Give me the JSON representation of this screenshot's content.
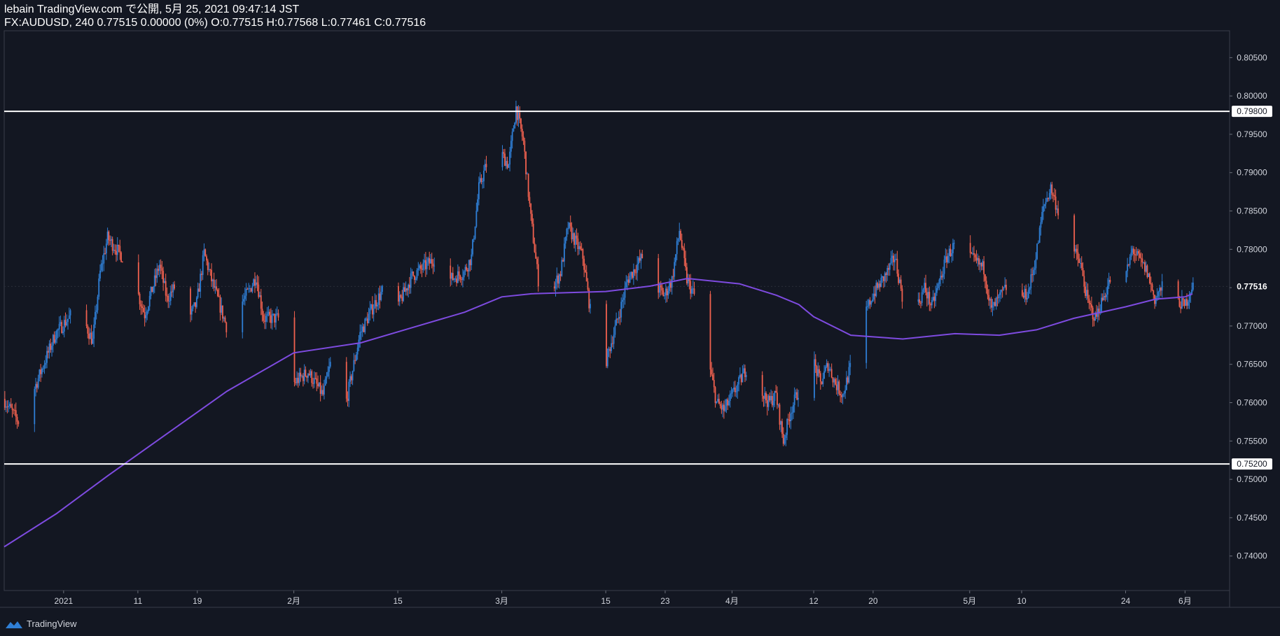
{
  "header": {
    "line1": "lebain TradingView.com で公開, 5月 25, 2021 09:47:14 JST",
    "line2": "FX:AUDUSD, 240 0.77515 0.00000 (0%) O:0.77515 H:0.77568 L:0.77461 C:0.77516"
  },
  "footer": {
    "brand": "TradingView",
    "logo_icon": "tradingview-cloud-icon"
  },
  "colors": {
    "background": "#131722",
    "up": "#2f7fd6",
    "down": "#f0614f",
    "ma": "#7e4be0",
    "levels": "#ffffff",
    "grid": "#2a2e39"
  },
  "chart_data": {
    "type": "candlestick",
    "symbol": "FX:AUDUSD",
    "interval": "240",
    "ylim": [
      0.7355,
      0.8085
    ],
    "y_ticks": [
      0.805,
      0.8,
      0.795,
      0.79,
      0.785,
      0.78,
      0.775,
      0.77,
      0.765,
      0.76,
      0.755,
      0.75,
      0.745,
      0.74
    ],
    "y_tick_labels": [
      "0.80500",
      "0.80000",
      "0.79500",
      "0.79000",
      "0.78500",
      "0.78000",
      "0.77500",
      "0.77000",
      "0.76500",
      "0.76000",
      "0.75500",
      "0.75000",
      "0.74500",
      "0.74000"
    ],
    "x_range": [
      "2020-12-24",
      "2021-06-07"
    ],
    "x_ticks": [
      {
        "date": "2021-01-01",
        "label": "2021"
      },
      {
        "date": "2021-01-11",
        "label": "11"
      },
      {
        "date": "2021-01-19",
        "label": "19"
      },
      {
        "date": "2021-02-01",
        "label": "2月"
      },
      {
        "date": "2021-02-15",
        "label": "15"
      },
      {
        "date": "2021-03-01",
        "label": "3月"
      },
      {
        "date": "2021-03-15",
        "label": "15"
      },
      {
        "date": "2021-03-23",
        "label": "23"
      },
      {
        "date": "2021-04-01",
        "label": "4月"
      },
      {
        "date": "2021-04-12",
        "label": "12"
      },
      {
        "date": "2021-04-20",
        "label": "20"
      },
      {
        "date": "2021-05-03",
        "label": "5月"
      },
      {
        "date": "2021-05-10",
        "label": "10"
      },
      {
        "date": "2021-05-24",
        "label": "24"
      },
      {
        "date": "2021-06-01",
        "label": "6月"
      }
    ],
    "price_path": [
      [
        "2020-12-24",
        0.7605
      ],
      [
        "2020-12-26",
        0.7575
      ],
      [
        "2020-12-28",
        0.7615
      ],
      [
        "2020-12-31",
        0.769
      ],
      [
        "2021-01-03",
        0.7725
      ],
      [
        "2021-01-05",
        0.768
      ],
      [
        "2021-01-06",
        0.777
      ],
      [
        "2021-01-07",
        0.7815
      ],
      [
        "2021-01-09",
        0.779
      ],
      [
        "2021-01-11",
        0.7745
      ],
      [
        "2021-01-12",
        0.7715
      ],
      [
        "2021-01-14",
        0.778
      ],
      [
        "2021-01-15",
        0.7735
      ],
      [
        "2021-01-17",
        0.7765
      ],
      [
        "2021-01-18",
        0.771
      ],
      [
        "2021-01-19",
        0.773
      ],
      [
        "2021-01-20",
        0.7795
      ],
      [
        "2021-01-21",
        0.776
      ],
      [
        "2021-01-23",
        0.77
      ],
      [
        "2021-01-26",
        0.7745
      ],
      [
        "2021-01-27",
        0.7765
      ],
      [
        "2021-01-28",
        0.771
      ],
      [
        "2021-01-30",
        0.771
      ],
      [
        "2021-02-01",
        0.7625
      ],
      [
        "2021-02-03",
        0.764
      ],
      [
        "2021-02-05",
        0.761
      ],
      [
        "2021-02-06",
        0.765
      ],
      [
        "2021-02-08",
        0.7595
      ],
      [
        "2021-02-10",
        0.769
      ],
      [
        "2021-02-12",
        0.773
      ],
      [
        "2021-02-13",
        0.7745
      ],
      [
        "2021-02-15",
        0.7725
      ],
      [
        "2021-02-17",
        0.7765
      ],
      [
        "2021-02-19",
        0.778
      ],
      [
        "2021-02-21",
        0.7795
      ],
      [
        "2021-02-22",
        0.776
      ],
      [
        "2021-02-24",
        0.777
      ],
      [
        "2021-02-25",
        0.779
      ],
      [
        "2021-02-26",
        0.788
      ],
      [
        "2021-02-27",
        0.791
      ],
      [
        "2021-03-01",
        0.7925
      ],
      [
        "2021-03-02",
        0.791
      ],
      [
        "2021-03-03",
        0.7985
      ],
      [
        "2021-03-04",
        0.794
      ],
      [
        "2021-03-05",
        0.784
      ],
      [
        "2021-03-06",
        0.776
      ],
      [
        "2021-03-07",
        0.773
      ],
      [
        "2021-03-09",
        0.777
      ],
      [
        "2021-03-10",
        0.783
      ],
      [
        "2021-03-12",
        0.779
      ],
      [
        "2021-03-13",
        0.772
      ],
      [
        "2021-03-14",
        0.766
      ],
      [
        "2021-03-15",
        0.765
      ],
      [
        "2021-03-17",
        0.772
      ],
      [
        "2021-03-18",
        0.776
      ],
      [
        "2021-03-20",
        0.779
      ],
      [
        "2021-03-21",
        0.776
      ],
      [
        "2021-03-22",
        0.775
      ],
      [
        "2021-03-23",
        0.774
      ],
      [
        "2021-03-24",
        0.776
      ],
      [
        "2021-03-25",
        0.7825
      ],
      [
        "2021-03-26",
        0.776
      ],
      [
        "2021-03-27",
        0.774
      ],
      [
        "2021-03-29",
        0.765
      ],
      [
        "2021-03-30",
        0.76
      ],
      [
        "2021-03-31",
        0.759
      ],
      [
        "2021-04-02",
        0.7625
      ],
      [
        "2021-04-03",
        0.7645
      ],
      [
        "2021-04-04",
        0.763
      ],
      [
        "2021-04-06",
        0.76
      ],
      [
        "2021-04-07",
        0.761
      ],
      [
        "2021-04-08",
        0.755
      ],
      [
        "2021-04-09",
        0.759
      ],
      [
        "2021-04-10",
        0.7615
      ],
      [
        "2021-04-11",
        0.7635
      ],
      [
        "2021-04-12",
        0.7655
      ],
      [
        "2021-04-13",
        0.7625
      ],
      [
        "2021-04-14",
        0.765
      ],
      [
        "2021-04-15",
        0.7625
      ],
      [
        "2021-04-16",
        0.761
      ],
      [
        "2021-04-17",
        0.7645
      ],
      [
        "2021-04-18",
        0.769
      ],
      [
        "2021-04-20",
        0.774
      ],
      [
        "2021-04-22",
        0.777
      ],
      [
        "2021-04-23",
        0.779
      ],
      [
        "2021-04-24",
        0.774
      ],
      [
        "2021-04-25",
        0.77
      ],
      [
        "2021-04-27",
        0.775
      ],
      [
        "2021-04-28",
        0.7725
      ],
      [
        "2021-04-30",
        0.779
      ],
      [
        "2021-05-01",
        0.7805
      ],
      [
        "2021-05-02",
        0.777
      ],
      [
        "2021-05-03",
        0.779
      ],
      [
        "2021-05-05",
        0.7775
      ],
      [
        "2021-05-06",
        0.772
      ],
      [
        "2021-05-08",
        0.775
      ],
      [
        "2021-05-09",
        0.77
      ],
      [
        "2021-05-10",
        0.7735
      ],
      [
        "2021-05-11",
        0.7745
      ],
      [
        "2021-05-12",
        0.779
      ],
      [
        "2021-05-13",
        0.7855
      ],
      [
        "2021-05-14",
        0.788
      ],
      [
        "2021-05-15",
        0.785
      ],
      [
        "2021-05-16",
        0.782
      ],
      [
        "2021-05-18",
        0.778
      ],
      [
        "2021-05-19",
        0.773
      ],
      [
        "2021-05-20",
        0.771
      ],
      [
        "2021-05-22",
        0.776
      ],
      [
        "2021-05-23",
        0.778
      ],
      [
        "2021-05-24",
        0.776
      ],
      [
        "2021-05-25",
        0.78
      ],
      [
        "2021-05-27",
        0.777
      ],
      [
        "2021-05-28",
        0.7735
      ],
      [
        "2021-05-29",
        0.775
      ],
      [
        "2021-05-30",
        0.777
      ],
      [
        "2021-05-31",
        0.7735
      ],
      [
        "2021-06-01",
        0.7725
      ],
      [
        "2021-06-02",
        0.7752
      ]
    ],
    "moving_average": {
      "points": [
        [
          "2020-12-24",
          0.7412
        ],
        [
          "2020-12-31",
          0.7455
        ],
        [
          "2021-01-07",
          0.7505
        ],
        [
          "2021-01-15",
          0.756
        ],
        [
          "2021-01-23",
          0.7615
        ],
        [
          "2021-02-01",
          0.7665
        ],
        [
          "2021-02-10",
          0.7678
        ],
        [
          "2021-02-17",
          0.7698
        ],
        [
          "2021-02-24",
          0.7718
        ],
        [
          "2021-03-01",
          0.7738
        ],
        [
          "2021-03-05",
          0.7742
        ],
        [
          "2021-03-15",
          0.7745
        ],
        [
          "2021-03-21",
          0.7752
        ],
        [
          "2021-03-26",
          0.7762
        ],
        [
          "2021-04-02",
          0.7755
        ],
        [
          "2021-04-07",
          0.774
        ],
        [
          "2021-04-10",
          0.7728
        ],
        [
          "2021-04-12",
          0.7712
        ],
        [
          "2021-04-17",
          0.7688
        ],
        [
          "2021-04-24",
          0.7683
        ],
        [
          "2021-05-01",
          0.769
        ],
        [
          "2021-05-07",
          0.7688
        ],
        [
          "2021-05-12",
          0.7695
        ],
        [
          "2021-05-17",
          0.771
        ],
        [
          "2021-05-24",
          0.7725
        ],
        [
          "2021-05-28",
          0.7735
        ],
        [
          "2021-06-01",
          0.7738
        ],
        [
          "2021-06-02",
          0.7742
        ]
      ]
    },
    "horizontal_levels": [
      {
        "value": 0.798,
        "label": "0.79800"
      },
      {
        "value": 0.752,
        "label": "0.75200"
      }
    ],
    "last_price": {
      "value": 0.77516,
      "label": "0.77516"
    }
  }
}
